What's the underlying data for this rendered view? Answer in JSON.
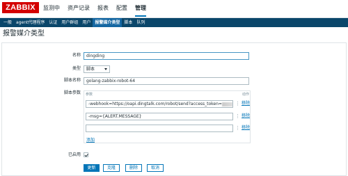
{
  "topnav": {
    "logo": "ZABBIX",
    "items": [
      "监测中",
      "资产记录",
      "报表",
      "配置",
      "管理"
    ]
  },
  "subnav": {
    "items": [
      "一般",
      "agent代理程序",
      "认证",
      "用户群组",
      "用户",
      "报警媒介类型",
      "脚本",
      "队列"
    ]
  },
  "page": {
    "title": "报警媒介类型"
  },
  "form": {
    "name_label": "名称",
    "name_value": "dingding",
    "type_label": "类型",
    "type_value": "脚本",
    "script_label": "脚本名称",
    "script_value": "golang-zabbix-robot-64",
    "params_label": "脚本参数",
    "params_col_param": "参数",
    "params_col_action": "动作",
    "params": [
      "-webhook=https://oapi.dingtalk.com/robot/send?access_token=",
      "-msg={ALERT.MESSAGE}",
      ""
    ],
    "remove_label": "移除",
    "add_label": "添加",
    "enabled_label": "已启用"
  },
  "buttons": {
    "update": "更新",
    "clone": "克隆",
    "delete": "删除",
    "cancel": "取消"
  },
  "colors": {
    "accent": "#0275b8",
    "subnav_bg": "#0a466a",
    "logo_bg": "#d40000"
  }
}
